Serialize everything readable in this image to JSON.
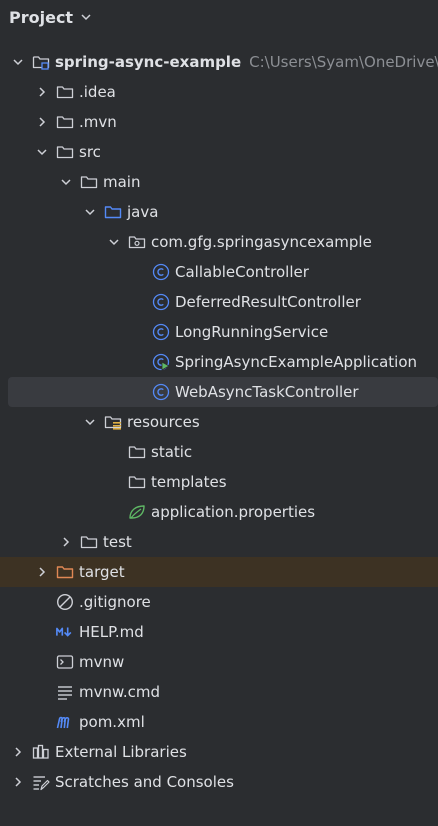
{
  "header": {
    "title": "Project"
  },
  "tree": {
    "root": {
      "label": "spring-async-example",
      "path": "C:\\Users\\Syam\\OneDrive\\Desktop\\spring-async-example"
    },
    "idea": {
      "label": ".idea"
    },
    "mvn": {
      "label": ".mvn"
    },
    "src": {
      "label": "src"
    },
    "main": {
      "label": "main"
    },
    "java": {
      "label": "java"
    },
    "package": {
      "label": "com.gfg.springasyncexample"
    },
    "callable": {
      "label": "CallableController"
    },
    "deferred": {
      "label": "DeferredResultController"
    },
    "longrunning": {
      "label": "LongRunningService"
    },
    "application": {
      "label": "SpringAsyncExampleApplication"
    },
    "webasync": {
      "label": "WebAsyncTaskController"
    },
    "resources": {
      "label": "resources"
    },
    "static": {
      "label": "static"
    },
    "templates": {
      "label": "templates"
    },
    "appprops": {
      "label": "application.properties"
    },
    "test": {
      "label": "test"
    },
    "target": {
      "label": "target"
    },
    "gitignore": {
      "label": ".gitignore"
    },
    "help": {
      "label": "HELP.md"
    },
    "mvnw": {
      "label": "mvnw"
    },
    "mvnwcmd": {
      "label": "mvnw.cmd"
    },
    "pom": {
      "label": "pom.xml"
    },
    "extlibs": {
      "label": "External Libraries"
    },
    "scratches": {
      "label": "Scratches and Consoles"
    }
  },
  "colors": {
    "background": "#2b2d30",
    "selected_row": "#393b40",
    "excluded_row": "#3d3223",
    "class_icon": "#548af7",
    "folder_icon": "#ced0d6",
    "source_folder_icon": "#548af7",
    "excluded_folder_icon": "#e08855",
    "spring_icon": "#5fb865"
  }
}
